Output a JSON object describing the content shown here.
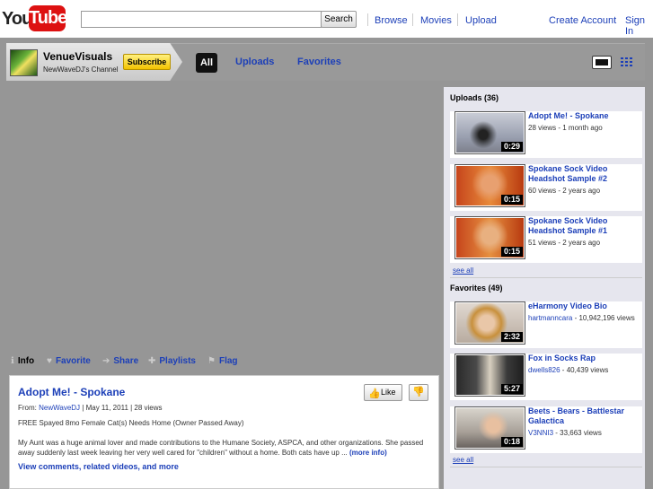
{
  "masthead": {
    "logo_you": "You",
    "logo_tube": "Tube",
    "search_placeholder": "",
    "search_label": "Search",
    "nav": [
      "Browse",
      "Movies",
      "Upload"
    ],
    "create_account": "Create Account",
    "sign_in": "Sign In"
  },
  "channel": {
    "name": "VenueVisuals",
    "subtitle": "NewWaveDJ's Channel",
    "subscribe": "Subscribe",
    "tabs": [
      "All",
      "Uploads",
      "Favorites"
    ]
  },
  "info_tabs": [
    "Info",
    "Favorite",
    "Share",
    "Playlists",
    "Flag"
  ],
  "video": {
    "title": "Adopt Me! - Spokane",
    "like": "Like",
    "from_label": "From:",
    "author": "NewWaveDJ",
    "date_views": "| May 11, 2011 | 28 views",
    "desc_short": "FREE Spayed 8mo Female Cat(s) Needs Home (Owner Passed Away)",
    "desc_long": "My Aunt was a huge animal lover and made contributions to the Humane Society, ASPCA, and other organizations. She passed away suddenly last week leaving her very well cared for \"children\" without a home. Both cats have up ...",
    "more_info": "(more info)",
    "view_comments": "View comments, related videos, and more"
  },
  "uploads": {
    "title": "Uploads (36)",
    "items": [
      {
        "title": "Adopt Me! - Spokane",
        "meta": "28 views - 1 month ago",
        "duration": "0:29"
      },
      {
        "title": "Spokane Sock Video Headshot Sample #2",
        "meta": "60 views - 2 years ago",
        "duration": "0:15"
      },
      {
        "title": "Spokane Sock Video Headshot Sample #1",
        "meta": "51 views - 2 years ago",
        "duration": "0:15"
      }
    ],
    "see_all": "see all"
  },
  "favorites": {
    "title": "Favorites (49)",
    "items": [
      {
        "title": "eHarmony Video Bio",
        "author": "hartmanncara",
        "meta": " - 10,942,196 views",
        "duration": "2:32"
      },
      {
        "title": "Fox in Socks Rap",
        "author": "dwells826",
        "meta": " - 40,439 views",
        "duration": "5:27"
      },
      {
        "title": "Beets - Bears - Battlestar Galactica",
        "author": "V3NNI3",
        "meta": " - 33,663 views",
        "duration": "0:18"
      }
    ],
    "see_all": "see all"
  }
}
